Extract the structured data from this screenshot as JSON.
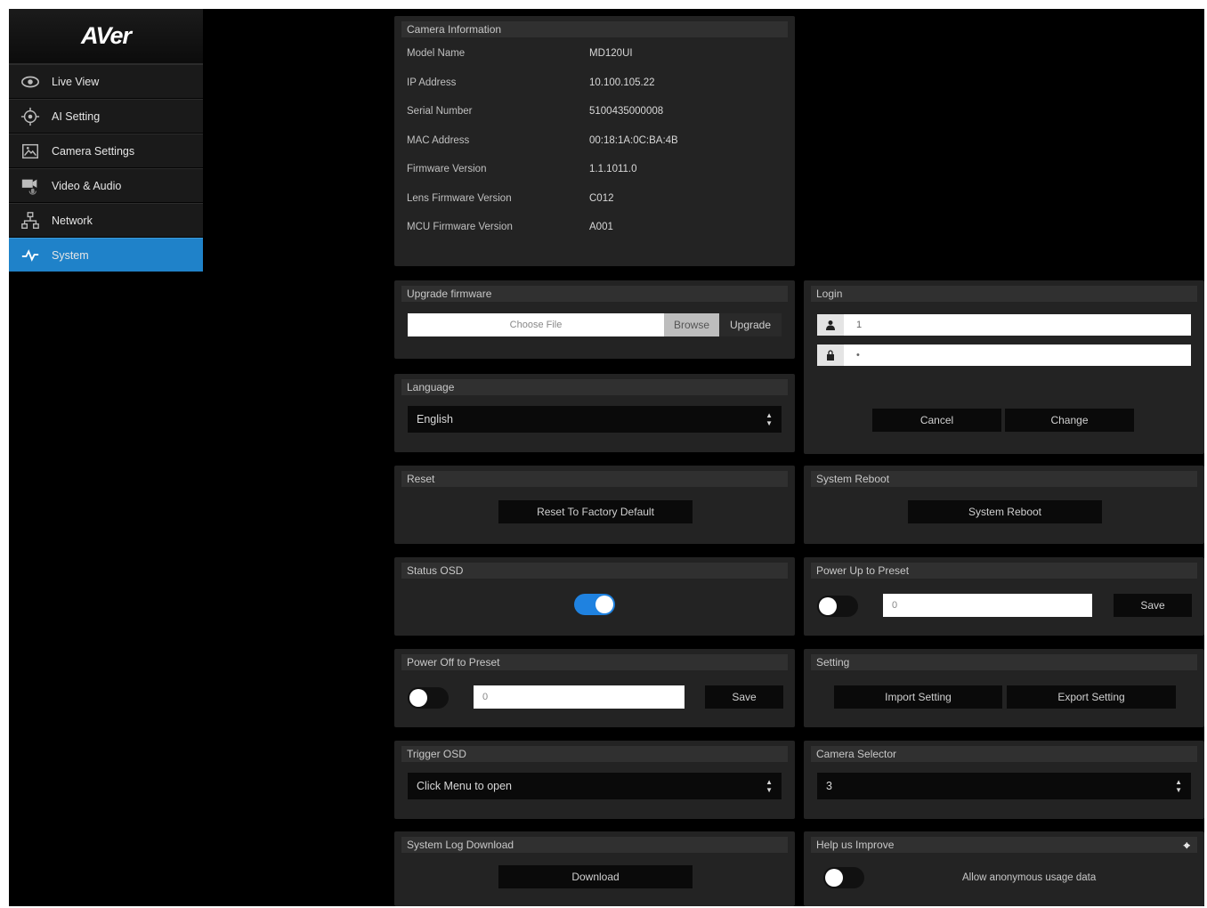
{
  "brand": {
    "logo_text": "AVer"
  },
  "sidebar": {
    "items": [
      {
        "label": "Live View",
        "icon": "eye-icon"
      },
      {
        "label": "AI Setting",
        "icon": "ai-target-icon"
      },
      {
        "label": "Camera Settings",
        "icon": "image-icon"
      },
      {
        "label": "Video & Audio",
        "icon": "video-audio-icon"
      },
      {
        "label": "Network",
        "icon": "network-icon"
      },
      {
        "label": "System",
        "icon": "pulse-icon",
        "active": true
      }
    ]
  },
  "camera_info": {
    "title": "Camera Information",
    "rows": [
      {
        "label": "Model Name",
        "value": "MD120UI"
      },
      {
        "label": "IP Address",
        "value": "10.100.105.22"
      },
      {
        "label": "Serial Number",
        "value": "5100435000008"
      },
      {
        "label": "MAC Address",
        "value": "00:18:1A:0C:BA:4B"
      },
      {
        "label": "Firmware Version",
        "value": "1.1.1011.0"
      },
      {
        "label": "Lens Firmware Version",
        "value": "C012"
      },
      {
        "label": "MCU Firmware Version",
        "value": "A001"
      }
    ]
  },
  "upgrade": {
    "title": "Upgrade firmware",
    "file_placeholder": "Choose File",
    "browse_label": "Browse",
    "upgrade_label": "Upgrade"
  },
  "login": {
    "title": "Login",
    "username_value": "1",
    "password_value": "•",
    "cancel_label": "Cancel",
    "change_label": "Change"
  },
  "language": {
    "title": "Language",
    "selected": "English"
  },
  "reset": {
    "title": "Reset",
    "button_label": "Reset To Factory Default"
  },
  "reboot": {
    "title": "System Reboot",
    "button_label": "System Reboot"
  },
  "status_osd": {
    "title": "Status OSD",
    "enabled": true
  },
  "power_up": {
    "title": "Power Up to Preset",
    "value": "0",
    "save_label": "Save",
    "enabled": false
  },
  "power_off": {
    "title": "Power Off to Preset",
    "value": "0",
    "save_label": "Save",
    "enabled": false
  },
  "setting": {
    "title": "Setting",
    "import_label": "Import Setting",
    "export_label": "Export Setting"
  },
  "trigger_osd": {
    "title": "Trigger OSD",
    "selected": "Click Menu to open"
  },
  "camera_selector": {
    "title": "Camera Selector",
    "selected": "3"
  },
  "log_download": {
    "title": "System Log Download",
    "button_label": "Download"
  },
  "help_improve": {
    "title": "Help us Improve",
    "toggle_label": "Allow anonymous usage data",
    "enabled": false
  },
  "colors": {
    "accent": "#1f82c9",
    "toggle_on": "#1f82e0",
    "panel": "#232323",
    "panel_header": "#303030",
    "background": "#000000"
  }
}
